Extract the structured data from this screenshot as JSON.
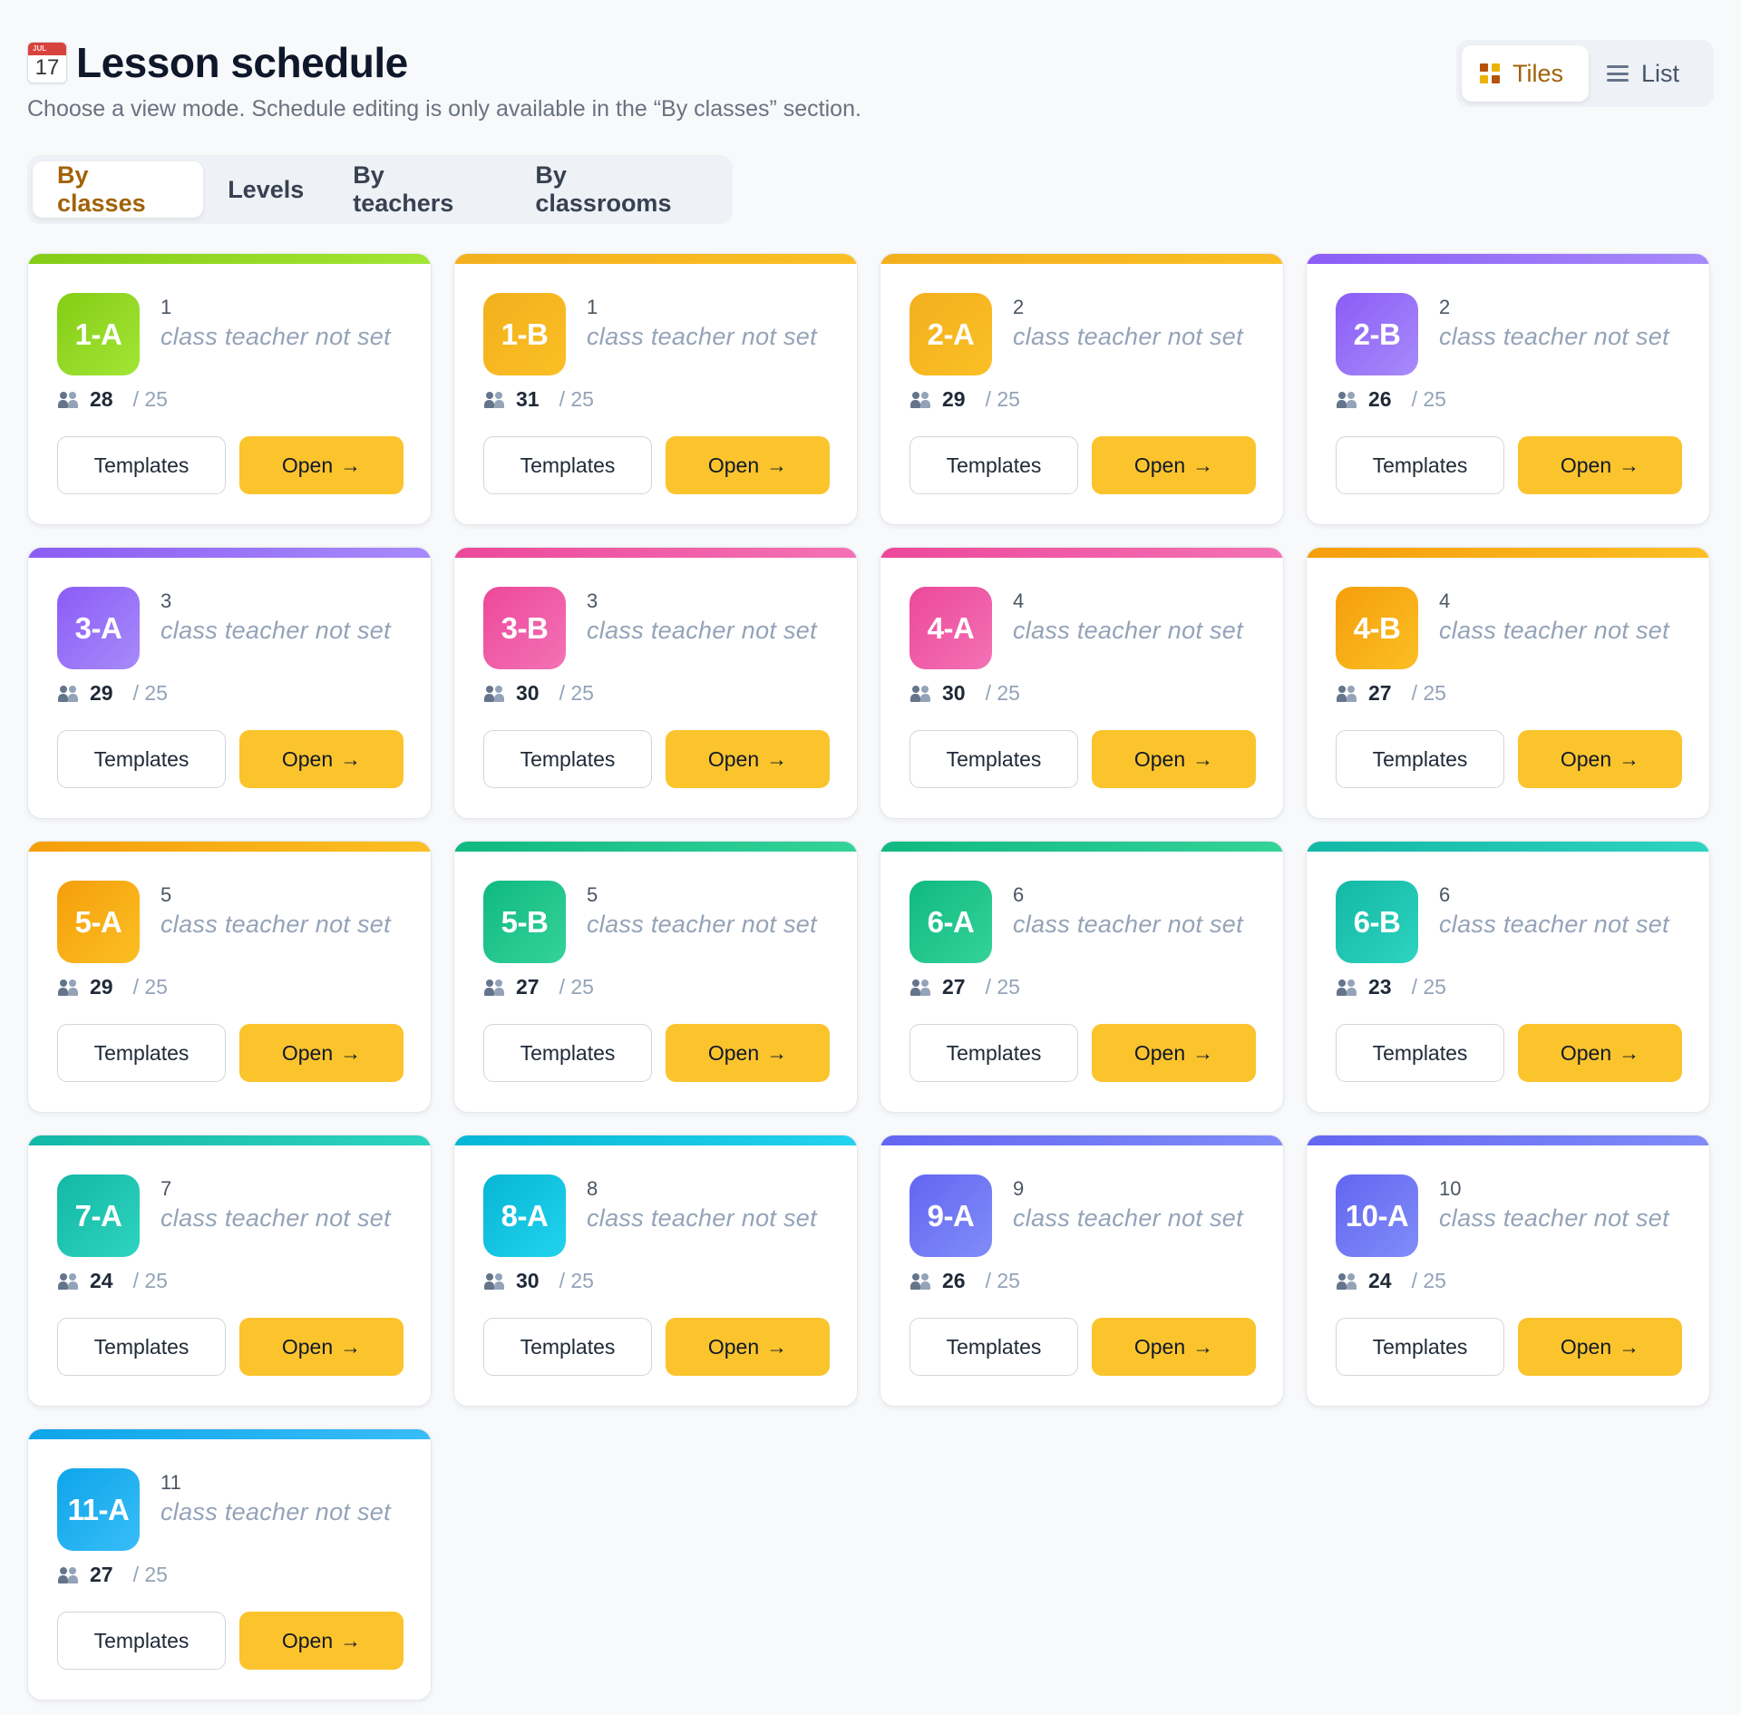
{
  "header": {
    "title": "Lesson schedule",
    "calendar_icon": {
      "month": "JUL",
      "day": "17"
    },
    "subtitle": "Choose a view mode. Schedule editing is only available in the “By classes” section."
  },
  "view_toggle": {
    "tiles_label": "Tiles",
    "list_label": "List",
    "active": "tiles"
  },
  "tabs": [
    {
      "label": "By classes",
      "active": true
    },
    {
      "label": "Levels",
      "active": false
    },
    {
      "label": "By teachers",
      "active": false
    },
    {
      "label": "By classrooms",
      "active": false
    }
  ],
  "card_labels": {
    "templates": "Templates",
    "open": "Open",
    "open_arrow": "→"
  },
  "classes": [
    {
      "name": "1-A",
      "grade": "1",
      "teacher": "class teacher not set",
      "count": "28",
      "capacity": "/ 25",
      "color": "#84cc16",
      "color2": "#a3e635"
    },
    {
      "name": "1-B",
      "grade": "1",
      "teacher": "class teacher not set",
      "count": "31",
      "capacity": "/ 25",
      "color": "#f2b01e",
      "color2": "#fbbf24"
    },
    {
      "name": "2-A",
      "grade": "2",
      "teacher": "class teacher not set",
      "count": "29",
      "capacity": "/ 25",
      "color": "#f2b01e",
      "color2": "#fbbf24"
    },
    {
      "name": "2-B",
      "grade": "2",
      "teacher": "class teacher not set",
      "count": "26",
      "capacity": "/ 25",
      "color": "#8b5cf6",
      "color2": "#a78bfa"
    },
    {
      "name": "3-A",
      "grade": "3",
      "teacher": "class teacher not set",
      "count": "29",
      "capacity": "/ 25",
      "color": "#8b5cf6",
      "color2": "#a78bfa"
    },
    {
      "name": "3-B",
      "grade": "3",
      "teacher": "class teacher not set",
      "count": "30",
      "capacity": "/ 25",
      "color": "#ec4899",
      "color2": "#f472b6"
    },
    {
      "name": "4-A",
      "grade": "4",
      "teacher": "class teacher not set",
      "count": "30",
      "capacity": "/ 25",
      "color": "#ec4899",
      "color2": "#f472b6"
    },
    {
      "name": "4-B",
      "grade": "4",
      "teacher": "class teacher not set",
      "count": "27",
      "capacity": "/ 25",
      "color": "#f59e0b",
      "color2": "#fbbf24"
    },
    {
      "name": "5-A",
      "grade": "5",
      "teacher": "class teacher not set",
      "count": "29",
      "capacity": "/ 25",
      "color": "#f59e0b",
      "color2": "#fbbf24"
    },
    {
      "name": "5-B",
      "grade": "5",
      "teacher": "class teacher not set",
      "count": "27",
      "capacity": "/ 25",
      "color": "#10b981",
      "color2": "#34d399"
    },
    {
      "name": "6-A",
      "grade": "6",
      "teacher": "class teacher not set",
      "count": "27",
      "capacity": "/ 25",
      "color": "#10b981",
      "color2": "#34d399"
    },
    {
      "name": "6-B",
      "grade": "6",
      "teacher": "class teacher not set",
      "count": "23",
      "capacity": "/ 25",
      "color": "#14b8a6",
      "color2": "#2dd4bf"
    },
    {
      "name": "7-A",
      "grade": "7",
      "teacher": "class teacher not set",
      "count": "24",
      "capacity": "/ 25",
      "color": "#14b8a6",
      "color2": "#2dd4bf"
    },
    {
      "name": "8-A",
      "grade": "8",
      "teacher": "class teacher not set",
      "count": "30",
      "capacity": "/ 25",
      "color": "#06b6d4",
      "color2": "#22d3ee"
    },
    {
      "name": "9-A",
      "grade": "9",
      "teacher": "class teacher not set",
      "count": "26",
      "capacity": "/ 25",
      "color": "#6366f1",
      "color2": "#818cf8"
    },
    {
      "name": "10-A",
      "grade": "10",
      "teacher": "class teacher not set",
      "count": "24",
      "capacity": "/ 25",
      "color": "#6366f1",
      "color2": "#818cf8"
    },
    {
      "name": "11-A",
      "grade": "11",
      "teacher": "class teacher not set",
      "count": "27",
      "capacity": "/ 25",
      "color": "#0ea5e9",
      "color2": "#38bdf8"
    }
  ]
}
